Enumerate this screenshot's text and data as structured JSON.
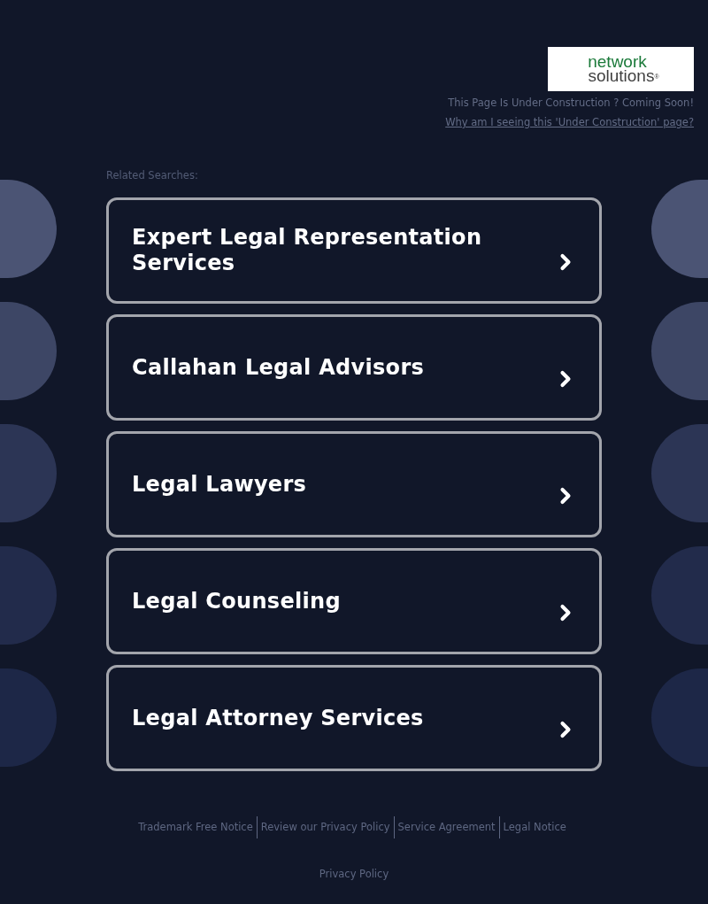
{
  "header": {
    "logo": {
      "line_1": "network",
      "line_2": "solutions$^{®}$"
    },
    "notice": "This Page Is Under Construction ? Coming Soon!",
    "help_link": "Why am I seeing this 'Under Construction' page?"
  },
  "related_searches": {
    "heading": "Related Searches:",
    "items": [
      "Expert Legal Representation Services",
      "Callahan Legal Advisors",
      "Legal Lawyers",
      "Legal Counseling",
      "Legal Attorney Services"
    ]
  },
  "footer": {
    "links": [
      "Trademark Free Notice",
      "Review our Privacy Policy",
      "Service Agreement",
      "Legal Notice"
    ],
    "privacy_link": "Privacy Policy"
  }
}
